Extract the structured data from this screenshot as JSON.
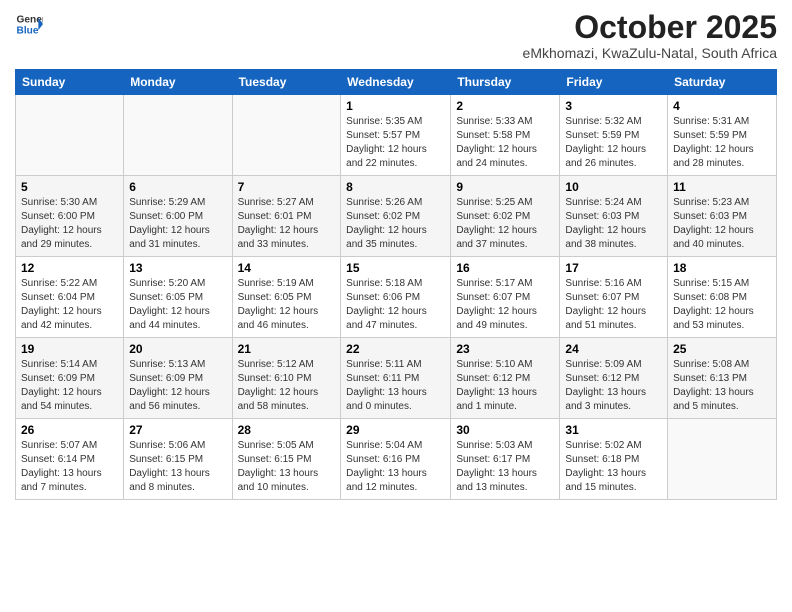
{
  "header": {
    "logo_line1": "General",
    "logo_line2": "Blue",
    "month": "October 2025",
    "location": "eMkhomazi, KwaZulu-Natal, South Africa"
  },
  "days_of_week": [
    "Sunday",
    "Monday",
    "Tuesday",
    "Wednesday",
    "Thursday",
    "Friday",
    "Saturday"
  ],
  "weeks": [
    [
      {
        "day": "",
        "info": ""
      },
      {
        "day": "",
        "info": ""
      },
      {
        "day": "",
        "info": ""
      },
      {
        "day": "1",
        "info": "Sunrise: 5:35 AM\nSunset: 5:57 PM\nDaylight: 12 hours\nand 22 minutes."
      },
      {
        "day": "2",
        "info": "Sunrise: 5:33 AM\nSunset: 5:58 PM\nDaylight: 12 hours\nand 24 minutes."
      },
      {
        "day": "3",
        "info": "Sunrise: 5:32 AM\nSunset: 5:59 PM\nDaylight: 12 hours\nand 26 minutes."
      },
      {
        "day": "4",
        "info": "Sunrise: 5:31 AM\nSunset: 5:59 PM\nDaylight: 12 hours\nand 28 minutes."
      }
    ],
    [
      {
        "day": "5",
        "info": "Sunrise: 5:30 AM\nSunset: 6:00 PM\nDaylight: 12 hours\nand 29 minutes."
      },
      {
        "day": "6",
        "info": "Sunrise: 5:29 AM\nSunset: 6:00 PM\nDaylight: 12 hours\nand 31 minutes."
      },
      {
        "day": "7",
        "info": "Sunrise: 5:27 AM\nSunset: 6:01 PM\nDaylight: 12 hours\nand 33 minutes."
      },
      {
        "day": "8",
        "info": "Sunrise: 5:26 AM\nSunset: 6:02 PM\nDaylight: 12 hours\nand 35 minutes."
      },
      {
        "day": "9",
        "info": "Sunrise: 5:25 AM\nSunset: 6:02 PM\nDaylight: 12 hours\nand 37 minutes."
      },
      {
        "day": "10",
        "info": "Sunrise: 5:24 AM\nSunset: 6:03 PM\nDaylight: 12 hours\nand 38 minutes."
      },
      {
        "day": "11",
        "info": "Sunrise: 5:23 AM\nSunset: 6:03 PM\nDaylight: 12 hours\nand 40 minutes."
      }
    ],
    [
      {
        "day": "12",
        "info": "Sunrise: 5:22 AM\nSunset: 6:04 PM\nDaylight: 12 hours\nand 42 minutes."
      },
      {
        "day": "13",
        "info": "Sunrise: 5:20 AM\nSunset: 6:05 PM\nDaylight: 12 hours\nand 44 minutes."
      },
      {
        "day": "14",
        "info": "Sunrise: 5:19 AM\nSunset: 6:05 PM\nDaylight: 12 hours\nand 46 minutes."
      },
      {
        "day": "15",
        "info": "Sunrise: 5:18 AM\nSunset: 6:06 PM\nDaylight: 12 hours\nand 47 minutes."
      },
      {
        "day": "16",
        "info": "Sunrise: 5:17 AM\nSunset: 6:07 PM\nDaylight: 12 hours\nand 49 minutes."
      },
      {
        "day": "17",
        "info": "Sunrise: 5:16 AM\nSunset: 6:07 PM\nDaylight: 12 hours\nand 51 minutes."
      },
      {
        "day": "18",
        "info": "Sunrise: 5:15 AM\nSunset: 6:08 PM\nDaylight: 12 hours\nand 53 minutes."
      }
    ],
    [
      {
        "day": "19",
        "info": "Sunrise: 5:14 AM\nSunset: 6:09 PM\nDaylight: 12 hours\nand 54 minutes."
      },
      {
        "day": "20",
        "info": "Sunrise: 5:13 AM\nSunset: 6:09 PM\nDaylight: 12 hours\nand 56 minutes."
      },
      {
        "day": "21",
        "info": "Sunrise: 5:12 AM\nSunset: 6:10 PM\nDaylight: 12 hours\nand 58 minutes."
      },
      {
        "day": "22",
        "info": "Sunrise: 5:11 AM\nSunset: 6:11 PM\nDaylight: 13 hours\nand 0 minutes."
      },
      {
        "day": "23",
        "info": "Sunrise: 5:10 AM\nSunset: 6:12 PM\nDaylight: 13 hours\nand 1 minute."
      },
      {
        "day": "24",
        "info": "Sunrise: 5:09 AM\nSunset: 6:12 PM\nDaylight: 13 hours\nand 3 minutes."
      },
      {
        "day": "25",
        "info": "Sunrise: 5:08 AM\nSunset: 6:13 PM\nDaylight: 13 hours\nand 5 minutes."
      }
    ],
    [
      {
        "day": "26",
        "info": "Sunrise: 5:07 AM\nSunset: 6:14 PM\nDaylight: 13 hours\nand 7 minutes."
      },
      {
        "day": "27",
        "info": "Sunrise: 5:06 AM\nSunset: 6:15 PM\nDaylight: 13 hours\nand 8 minutes."
      },
      {
        "day": "28",
        "info": "Sunrise: 5:05 AM\nSunset: 6:15 PM\nDaylight: 13 hours\nand 10 minutes."
      },
      {
        "day": "29",
        "info": "Sunrise: 5:04 AM\nSunset: 6:16 PM\nDaylight: 13 hours\nand 12 minutes."
      },
      {
        "day": "30",
        "info": "Sunrise: 5:03 AM\nSunset: 6:17 PM\nDaylight: 13 hours\nand 13 minutes."
      },
      {
        "day": "31",
        "info": "Sunrise: 5:02 AM\nSunset: 6:18 PM\nDaylight: 13 hours\nand 15 minutes."
      },
      {
        "day": "",
        "info": ""
      }
    ]
  ]
}
